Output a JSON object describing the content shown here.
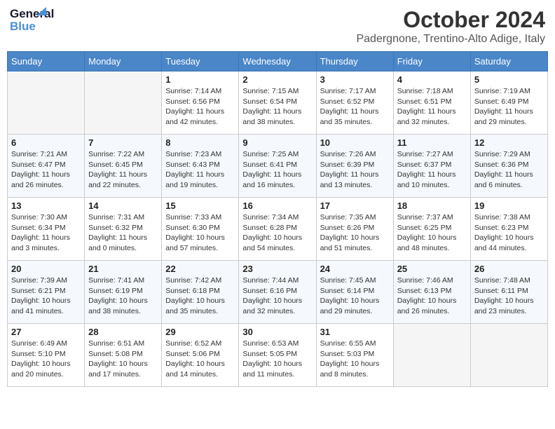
{
  "header": {
    "logo_general": "General",
    "logo_blue": "Blue",
    "month_year": "October 2024",
    "location": "Padergnone, Trentino-Alto Adige, Italy"
  },
  "days_of_week": [
    "Sunday",
    "Monday",
    "Tuesday",
    "Wednesday",
    "Thursday",
    "Friday",
    "Saturday"
  ],
  "weeks": [
    [
      {
        "day": "",
        "info": ""
      },
      {
        "day": "",
        "info": ""
      },
      {
        "day": "1",
        "info": "Sunrise: 7:14 AM\nSunset: 6:56 PM\nDaylight: 11 hours and 42 minutes."
      },
      {
        "day": "2",
        "info": "Sunrise: 7:15 AM\nSunset: 6:54 PM\nDaylight: 11 hours and 38 minutes."
      },
      {
        "day": "3",
        "info": "Sunrise: 7:17 AM\nSunset: 6:52 PM\nDaylight: 11 hours and 35 minutes."
      },
      {
        "day": "4",
        "info": "Sunrise: 7:18 AM\nSunset: 6:51 PM\nDaylight: 11 hours and 32 minutes."
      },
      {
        "day": "5",
        "info": "Sunrise: 7:19 AM\nSunset: 6:49 PM\nDaylight: 11 hours and 29 minutes."
      }
    ],
    [
      {
        "day": "6",
        "info": "Sunrise: 7:21 AM\nSunset: 6:47 PM\nDaylight: 11 hours and 26 minutes."
      },
      {
        "day": "7",
        "info": "Sunrise: 7:22 AM\nSunset: 6:45 PM\nDaylight: 11 hours and 22 minutes."
      },
      {
        "day": "8",
        "info": "Sunrise: 7:23 AM\nSunset: 6:43 PM\nDaylight: 11 hours and 19 minutes."
      },
      {
        "day": "9",
        "info": "Sunrise: 7:25 AM\nSunset: 6:41 PM\nDaylight: 11 hours and 16 minutes."
      },
      {
        "day": "10",
        "info": "Sunrise: 7:26 AM\nSunset: 6:39 PM\nDaylight: 11 hours and 13 minutes."
      },
      {
        "day": "11",
        "info": "Sunrise: 7:27 AM\nSunset: 6:37 PM\nDaylight: 11 hours and 10 minutes."
      },
      {
        "day": "12",
        "info": "Sunrise: 7:29 AM\nSunset: 6:36 PM\nDaylight: 11 hours and 6 minutes."
      }
    ],
    [
      {
        "day": "13",
        "info": "Sunrise: 7:30 AM\nSunset: 6:34 PM\nDaylight: 11 hours and 3 minutes."
      },
      {
        "day": "14",
        "info": "Sunrise: 7:31 AM\nSunset: 6:32 PM\nDaylight: 11 hours and 0 minutes."
      },
      {
        "day": "15",
        "info": "Sunrise: 7:33 AM\nSunset: 6:30 PM\nDaylight: 10 hours and 57 minutes."
      },
      {
        "day": "16",
        "info": "Sunrise: 7:34 AM\nSunset: 6:28 PM\nDaylight: 10 hours and 54 minutes."
      },
      {
        "day": "17",
        "info": "Sunrise: 7:35 AM\nSunset: 6:26 PM\nDaylight: 10 hours and 51 minutes."
      },
      {
        "day": "18",
        "info": "Sunrise: 7:37 AM\nSunset: 6:25 PM\nDaylight: 10 hours and 48 minutes."
      },
      {
        "day": "19",
        "info": "Sunrise: 7:38 AM\nSunset: 6:23 PM\nDaylight: 10 hours and 44 minutes."
      }
    ],
    [
      {
        "day": "20",
        "info": "Sunrise: 7:39 AM\nSunset: 6:21 PM\nDaylight: 10 hours and 41 minutes."
      },
      {
        "day": "21",
        "info": "Sunrise: 7:41 AM\nSunset: 6:19 PM\nDaylight: 10 hours and 38 minutes."
      },
      {
        "day": "22",
        "info": "Sunrise: 7:42 AM\nSunset: 6:18 PM\nDaylight: 10 hours and 35 minutes."
      },
      {
        "day": "23",
        "info": "Sunrise: 7:44 AM\nSunset: 6:16 PM\nDaylight: 10 hours and 32 minutes."
      },
      {
        "day": "24",
        "info": "Sunrise: 7:45 AM\nSunset: 6:14 PM\nDaylight: 10 hours and 29 minutes."
      },
      {
        "day": "25",
        "info": "Sunrise: 7:46 AM\nSunset: 6:13 PM\nDaylight: 10 hours and 26 minutes."
      },
      {
        "day": "26",
        "info": "Sunrise: 7:48 AM\nSunset: 6:11 PM\nDaylight: 10 hours and 23 minutes."
      }
    ],
    [
      {
        "day": "27",
        "info": "Sunrise: 6:49 AM\nSunset: 5:10 PM\nDaylight: 10 hours and 20 minutes."
      },
      {
        "day": "28",
        "info": "Sunrise: 6:51 AM\nSunset: 5:08 PM\nDaylight: 10 hours and 17 minutes."
      },
      {
        "day": "29",
        "info": "Sunrise: 6:52 AM\nSunset: 5:06 PM\nDaylight: 10 hours and 14 minutes."
      },
      {
        "day": "30",
        "info": "Sunrise: 6:53 AM\nSunset: 5:05 PM\nDaylight: 10 hours and 11 minutes."
      },
      {
        "day": "31",
        "info": "Sunrise: 6:55 AM\nSunset: 5:03 PM\nDaylight: 10 hours and 8 minutes."
      },
      {
        "day": "",
        "info": ""
      },
      {
        "day": "",
        "info": ""
      }
    ]
  ]
}
